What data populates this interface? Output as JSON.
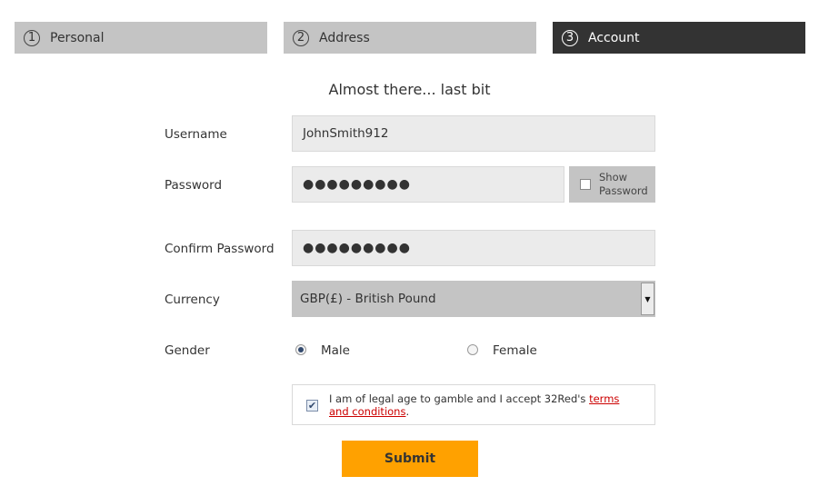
{
  "steps": [
    {
      "number": "1",
      "label": "Personal"
    },
    {
      "number": "2",
      "label": "Address"
    },
    {
      "number": "3",
      "label": "Account"
    }
  ],
  "subtitle": "Almost there... last bit",
  "form": {
    "username_label": "Username",
    "username_value": "JohnSmith912",
    "password_label": "Password",
    "password_value": "●●●●●●●●●",
    "show_password_label_line1": "Show",
    "show_password_label_line2": "Password",
    "confirm_password_label": "Confirm Password",
    "confirm_password_value": "●●●●●●●●●",
    "currency_label": "Currency",
    "currency_value": "GBP(£) - British Pound",
    "gender_label": "Gender",
    "gender_options": [
      "Male",
      "Female"
    ],
    "gender_selected": "Male",
    "terms_text": "I am of legal age to gamble and I accept 32Red's ",
    "terms_link": "terms and conditions",
    "terms_suffix": ".",
    "submit_label": "Submit"
  },
  "colors": {
    "active_step": "#333333",
    "inactive_step": "#c4c4c4",
    "submit": "#ffa100",
    "link": "#cc0000"
  }
}
